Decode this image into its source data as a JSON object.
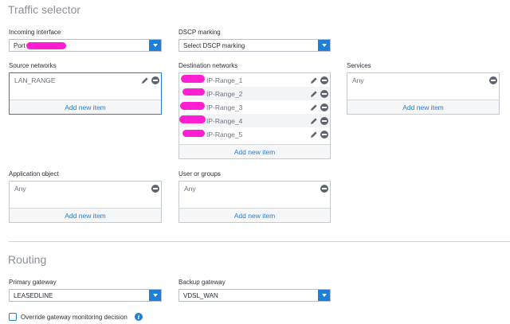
{
  "traffic_selector": {
    "title": "Traffic selector",
    "incoming_interface": {
      "label": "Incoming interface",
      "value": "Port"
    },
    "dscp_marking": {
      "label": "DSCP marking",
      "value": "Select DSCP marking"
    },
    "source_networks": {
      "label": "Source networks",
      "items": [
        "LAN_RANGE"
      ],
      "add_label": "Add new item"
    },
    "destination_networks": {
      "label": "Destination networks",
      "items": [
        "IP-Range_1",
        "IP-Range_2",
        "IP-Range_3",
        "IP-Range_4",
        "IP-Range_5"
      ],
      "add_label": "Add new item"
    },
    "services": {
      "label": "Services",
      "items": [
        "Any"
      ],
      "add_label": "Add new item"
    },
    "application_object": {
      "label": "Application object",
      "items": [
        "Any"
      ],
      "add_label": "Add new item"
    },
    "user_or_groups": {
      "label": "User or groups",
      "items": [
        "Any"
      ],
      "add_label": "Add new item"
    }
  },
  "routing": {
    "title": "Routing",
    "primary_gateway": {
      "label": "Primary gateway",
      "value": "LEASEDLINE"
    },
    "backup_gateway": {
      "label": "Backup gateway",
      "value": "VDSL_WAN"
    },
    "override_checkbox_label": "Override gateway monitoring decision"
  },
  "colors": {
    "accent": "#1f7fd6",
    "redaction": "#ff1ed2"
  },
  "icons": [
    "chevron-down-icon",
    "edit-pencil-icon",
    "remove-minus-icon",
    "info-icon",
    "checkbox-icon"
  ]
}
